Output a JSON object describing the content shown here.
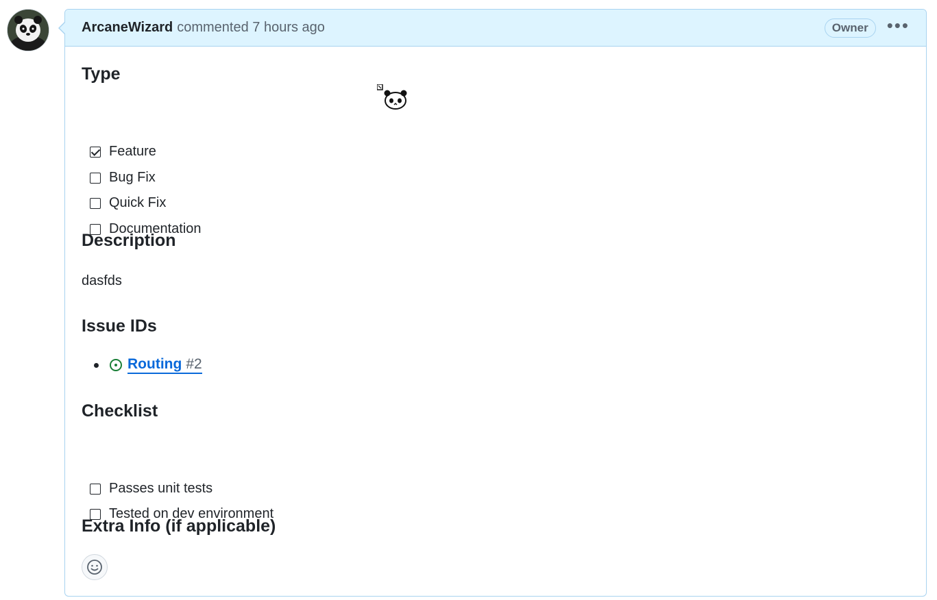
{
  "comment": {
    "author": "ArcaneWizard",
    "action": "commented",
    "time": "7 hours ago",
    "badge": "Owner",
    "more_icon": "kebab-horizontal-icon"
  },
  "sections": {
    "type": {
      "heading": "Type",
      "items": [
        {
          "label": "Feature",
          "checked": true
        },
        {
          "label": "Bug Fix",
          "checked": false
        },
        {
          "label": "Quick Fix",
          "checked": false
        },
        {
          "label": "Documentation",
          "checked": false
        }
      ]
    },
    "description": {
      "heading": "Description",
      "text": "dasfds"
    },
    "issues": {
      "heading": "Issue IDs",
      "items": [
        {
          "title": "Routing",
          "number": "#2",
          "status_color": "#1a7f37"
        }
      ]
    },
    "checklist": {
      "heading": "Checklist",
      "items": [
        {
          "label": "Passes unit tests",
          "checked": false
        },
        {
          "label": "Tested on dev environment",
          "checked": false
        }
      ]
    },
    "extra": {
      "heading": "Extra Info (if applicable)"
    }
  },
  "reaction_icon": "smiley-icon",
  "colors": {
    "header_bg": "#ddf4ff",
    "border": "#a8d3f0",
    "link": "#0969da",
    "open_issue": "#1a7f37"
  }
}
